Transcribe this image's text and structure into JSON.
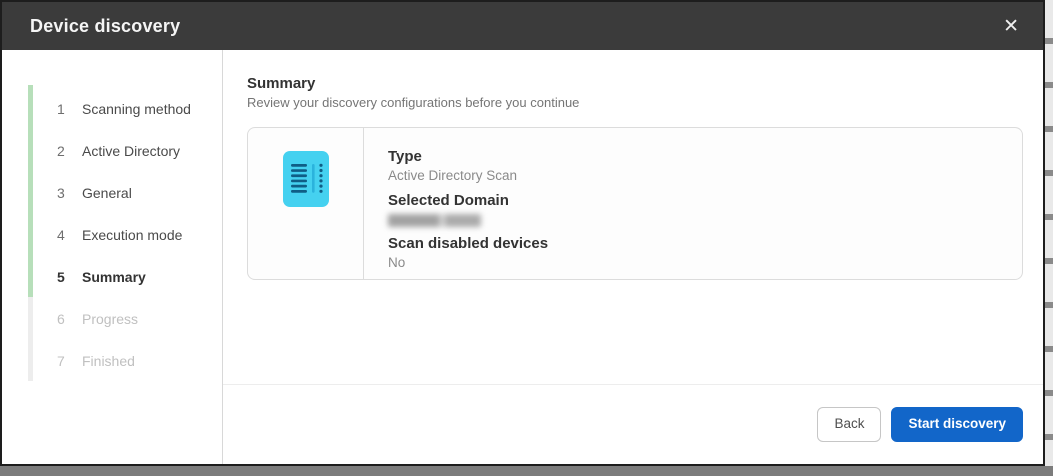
{
  "dialog": {
    "title": "Device discovery",
    "close_icon": "✕"
  },
  "steps": [
    {
      "number": "1",
      "label": "Scanning method",
      "state": "done"
    },
    {
      "number": "2",
      "label": "Active Directory",
      "state": "done"
    },
    {
      "number": "3",
      "label": "General",
      "state": "done"
    },
    {
      "number": "4",
      "label": "Execution mode",
      "state": "done"
    },
    {
      "number": "5",
      "label": "Summary",
      "state": "active"
    },
    {
      "number": "6",
      "label": "Progress",
      "state": "disabled"
    },
    {
      "number": "7",
      "label": "Finished",
      "state": "disabled"
    }
  ],
  "main": {
    "heading": "Summary",
    "subheading": "Review your discovery configurations before you continue",
    "summary_card": {
      "icon": "scan-list-icon",
      "fields": [
        {
          "label": "Type",
          "value": "Active Directory Scan",
          "redacted": false
        },
        {
          "label": "Selected Domain",
          "value": "",
          "redacted": true
        },
        {
          "label": "Scan disabled devices",
          "value": "No",
          "redacted": false
        }
      ]
    }
  },
  "footer": {
    "back_label": "Back",
    "start_label": "Start discovery"
  },
  "colors": {
    "header_bg": "#3b3b3b",
    "accent_blue": "#1266c9",
    "progress_green": "#b7dfba",
    "icon_cyan": "#45d1f0",
    "icon_mark_dark": "#0f5e86"
  }
}
